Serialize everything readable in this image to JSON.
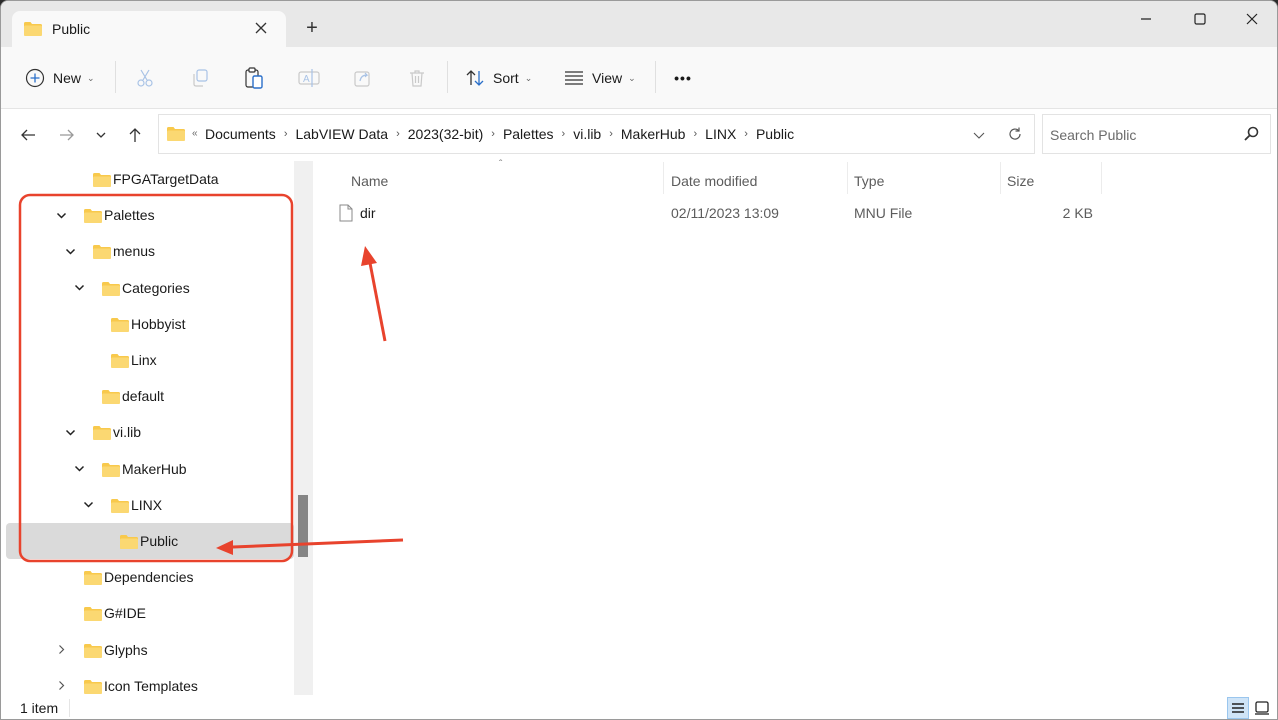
{
  "window": {
    "tab_title": "Public",
    "new_tab_symbol": "+",
    "controls": {
      "minimize": "minimize-icon",
      "maximize": "maximize-icon",
      "close": "close-icon"
    }
  },
  "commandbar": {
    "new_label": "New",
    "sort_label": "Sort",
    "view_label": "View",
    "more_label": "•••",
    "icons": [
      "plus-circle-icon",
      "cut-icon",
      "copy-icon",
      "paste-icon",
      "rename-icon",
      "share-icon",
      "delete-icon",
      "sort-icon",
      "view-icon",
      "more-icon"
    ]
  },
  "addressbar": {
    "overflow": "«",
    "breadcrumbs": [
      "Documents",
      "LabVIEW Data",
      "2023(32-bit)",
      "Palettes",
      "vi.lib",
      "MakerHub",
      "LINX",
      "Public"
    ],
    "search_placeholder": "Search Public",
    "search_value": ""
  },
  "navpane": {
    "items": [
      {
        "label": "FPGATargetData",
        "expander": "none",
        "level": 2
      },
      {
        "label": "Palettes",
        "expander": "expanded",
        "level": 1
      },
      {
        "label": "menus",
        "expander": "expanded",
        "level": 2
      },
      {
        "label": "Categories",
        "expander": "expanded",
        "level": 3
      },
      {
        "label": "Hobbyist",
        "expander": "none",
        "level": 4
      },
      {
        "label": "Linx",
        "expander": "none",
        "level": 4
      },
      {
        "label": "default",
        "expander": "none",
        "level": 3
      },
      {
        "label": "vi.lib",
        "expander": "expanded",
        "level": 2
      },
      {
        "label": "MakerHub",
        "expander": "expanded",
        "level": 3
      },
      {
        "label": "LINX",
        "expander": "expanded",
        "level": 4
      },
      {
        "label": "Public",
        "expander": "none",
        "level": 5,
        "selected": true
      },
      {
        "label": "Dependencies",
        "expander": "none",
        "level": 1
      },
      {
        "label": "G#IDE",
        "expander": "none",
        "level": 1
      },
      {
        "label": "Glyphs",
        "expander": "collapsed",
        "level": 1
      },
      {
        "label": "Icon Templates",
        "expander": "collapsed",
        "level": 1
      }
    ]
  },
  "filelist": {
    "columns": [
      "Name",
      "Date modified",
      "Type",
      "Size"
    ],
    "sorted_by": "Name",
    "rows": [
      {
        "name": "dir",
        "date_modified": "02/11/2023 13:09",
        "type": "MNU File",
        "size": "2 KB"
      }
    ]
  },
  "statusbar": {
    "item_count": "1 item",
    "view_modes": [
      "details",
      "tiles"
    ],
    "active_view": "details"
  },
  "annotations": {
    "color": "#e8432d"
  }
}
